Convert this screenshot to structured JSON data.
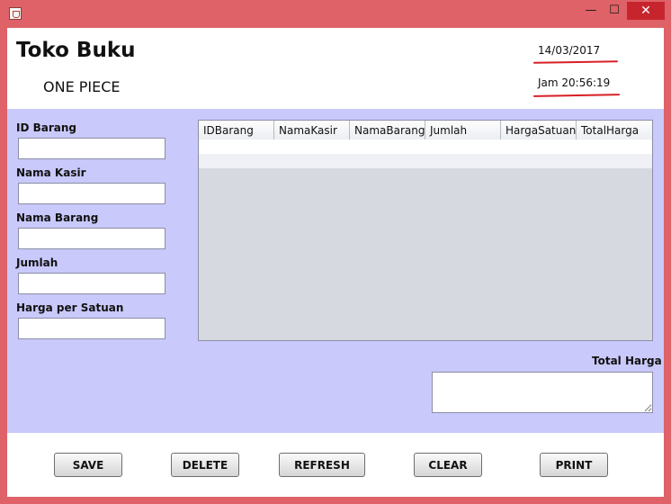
{
  "window": {
    "minimize_glyph": "—",
    "maximize_glyph": "☐",
    "close_glyph": "✕"
  },
  "header": {
    "store_name": "Toko Buku",
    "branch": "ONE PIECE",
    "date": "14/03/2017",
    "time": "Jam 20:56:19"
  },
  "form": {
    "fields": [
      {
        "label": "ID Barang",
        "value": ""
      },
      {
        "label": "Nama Kasir",
        "value": ""
      },
      {
        "label": "Nama Barang",
        "value": ""
      },
      {
        "label": "Jumlah",
        "value": ""
      },
      {
        "label": "Harga per Satuan",
        "value": ""
      }
    ]
  },
  "table": {
    "columns": [
      "IDBarang",
      "NamaKasir",
      "NamaBarang",
      "Jumlah",
      "HargaSatuan",
      "TotalHarga"
    ]
  },
  "total": {
    "label": "Total Harga",
    "value": ""
  },
  "buttons": {
    "save": "SAVE",
    "delete": "DELETE",
    "refresh": "REFRESH",
    "clear": "CLEAR",
    "print": "PRINT"
  },
  "colors": {
    "window_frame": "#de6267",
    "panel_bg": "#c9c9fb",
    "annotation_red": "#d81f26"
  }
}
